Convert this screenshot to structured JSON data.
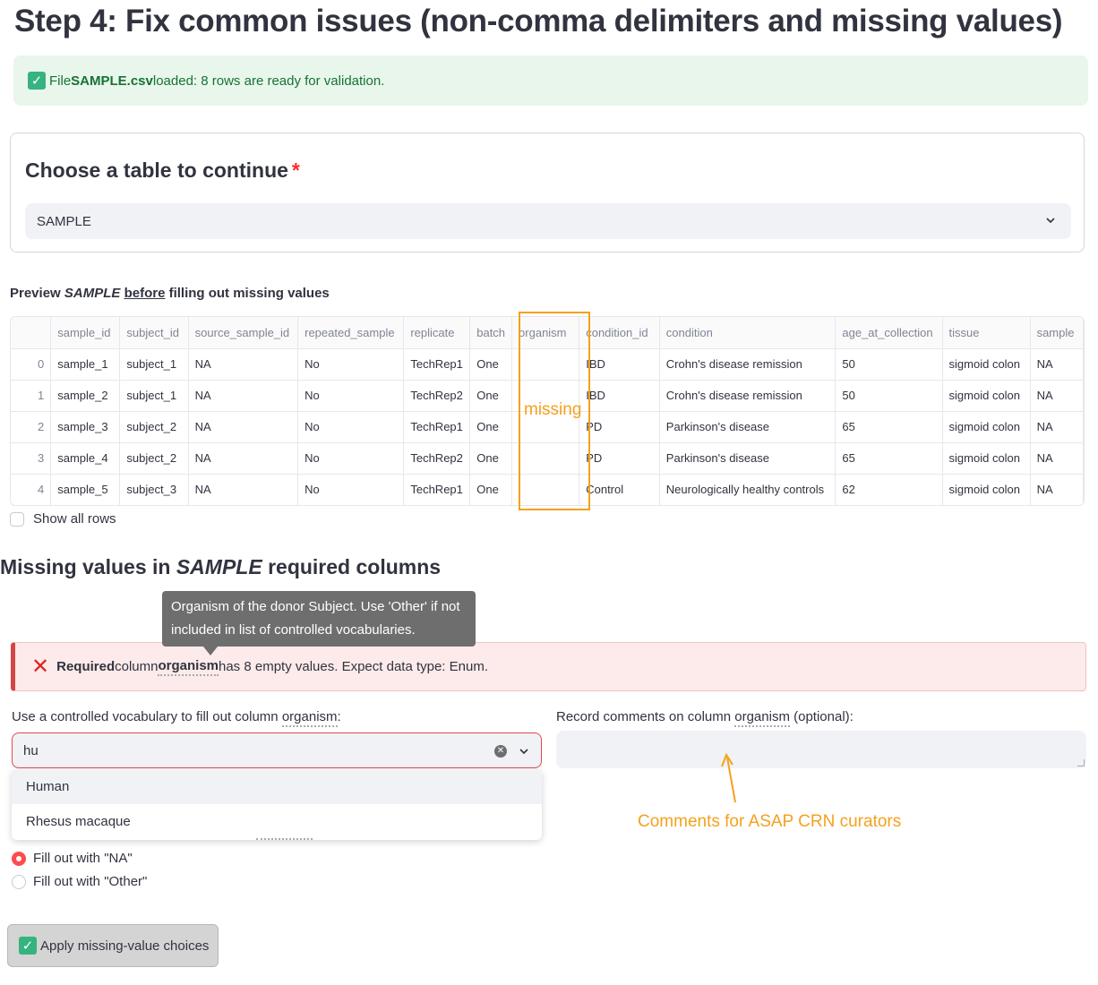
{
  "page": {
    "title": "Step 4: Fix common issues (non-comma delimiters and missing values)"
  },
  "success": {
    "prefix": "File ",
    "filename": "SAMPLE.csv",
    "suffix": " loaded: 8 rows are ready for validation."
  },
  "table_select": {
    "title": "Choose a table to continue",
    "required_mark": "*",
    "selected": "SAMPLE"
  },
  "preview": {
    "label_prefix": "Preview ",
    "label_table": "SAMPLE",
    "label_before": "before",
    "label_suffix": " filling out missing values",
    "columns": [
      "",
      "sample_id",
      "subject_id",
      "source_sample_id",
      "repeated_sample",
      "replicate",
      "batch",
      "organism",
      "condition_id",
      "condition",
      "age_at_collection",
      "tissue",
      "sample"
    ],
    "rows": [
      [
        "0",
        "sample_1",
        "subject_1",
        "NA",
        "No",
        "TechRep1",
        "One",
        "",
        "IBD",
        "Crohn's disease remission",
        "50",
        "sigmoid colon",
        "NA"
      ],
      [
        "1",
        "sample_2",
        "subject_1",
        "NA",
        "No",
        "TechRep2",
        "One",
        "",
        "IBD",
        "Crohn's disease remission",
        "50",
        "sigmoid colon",
        "NA"
      ],
      [
        "2",
        "sample_3",
        "subject_2",
        "NA",
        "No",
        "TechRep1",
        "One",
        "",
        "PD",
        "Parkinson's disease",
        "65",
        "sigmoid colon",
        "NA"
      ],
      [
        "3",
        "sample_4",
        "subject_2",
        "NA",
        "No",
        "TechRep2",
        "One",
        "",
        "PD",
        "Parkinson's disease",
        "65",
        "sigmoid colon",
        "NA"
      ],
      [
        "4",
        "sample_5",
        "subject_3",
        "NA",
        "No",
        "TechRep1",
        "One",
        "",
        "Control",
        "Neurologically healthy controls",
        "62",
        "sigmoid colon",
        "NA"
      ]
    ],
    "missing_annotation": "missing",
    "show_all_rows": "Show all rows"
  },
  "missing_section": {
    "title_prefix": "Missing values in ",
    "title_table": "SAMPLE",
    "title_suffix": " required columns",
    "tooltip": "Organism of the donor Subject. Use 'Other' if not included in list of controlled vocabularies.",
    "error_required": "Required",
    "error_column_word": " column ",
    "error_column": "organism",
    "error_rest": " has 8 empty values. Expect data type: Enum.",
    "vocab_label_prefix": "Use a controlled vocabulary to fill out column ",
    "vocab_label_column": "organism",
    "vocab_label_suffix": ":",
    "vocab_input_value": "hu",
    "vocab_options": [
      "Human",
      "Rhesus macaque"
    ],
    "comments_label_prefix": "Record comments on column ",
    "comments_label_column": "organism",
    "comments_label_suffix": " (optional):",
    "comments_annotation": "Comments for ASAP CRN curators",
    "radio_na": "Fill out with \"NA\"",
    "radio_other": "Fill out with \"Other\"",
    "apply_button": "Apply missing-value choices"
  },
  "colors": {
    "accent": "#ff4b4b",
    "annotation": "#f5a11c",
    "success_bg": "#e8f6ec",
    "error_bg": "#fdeaea"
  }
}
